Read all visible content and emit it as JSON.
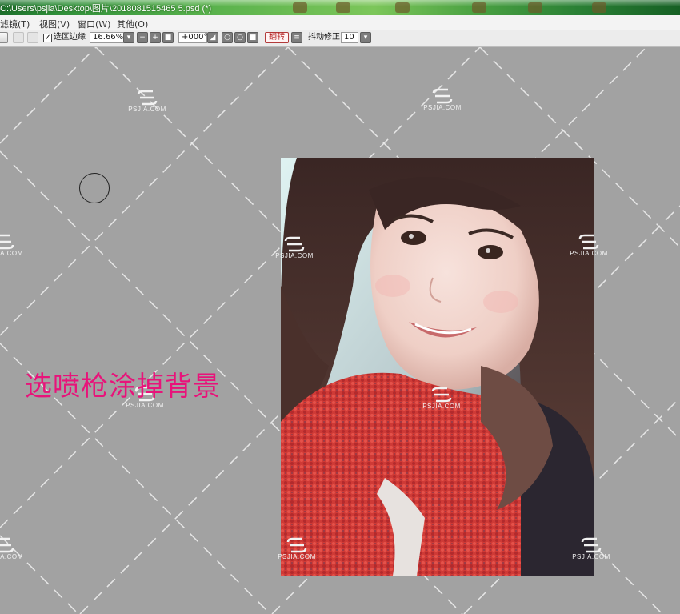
{
  "window": {
    "title": "C:\\Users\\psjia\\Desktop\\图片\\2018081515465 5.psd (*)"
  },
  "menu": {
    "items": [
      "滤镜(T)",
      "视图(V)",
      "窗口(W)",
      "其他(O)"
    ]
  },
  "toolbar": {
    "selection_edge_label": "选区边缘",
    "selection_edge_checked": true,
    "zoom_value": "16.66%",
    "rotation_value": "+000°",
    "flip_label": "翻转",
    "stabilizer_label": "抖动修正",
    "stabilizer_value": "10"
  },
  "canvas": {
    "caption": "选喷枪涂掉背景",
    "caption_color": "#e8137a",
    "background_color": "#a2a2a2",
    "watermark_text": "PSJIA.COM"
  }
}
